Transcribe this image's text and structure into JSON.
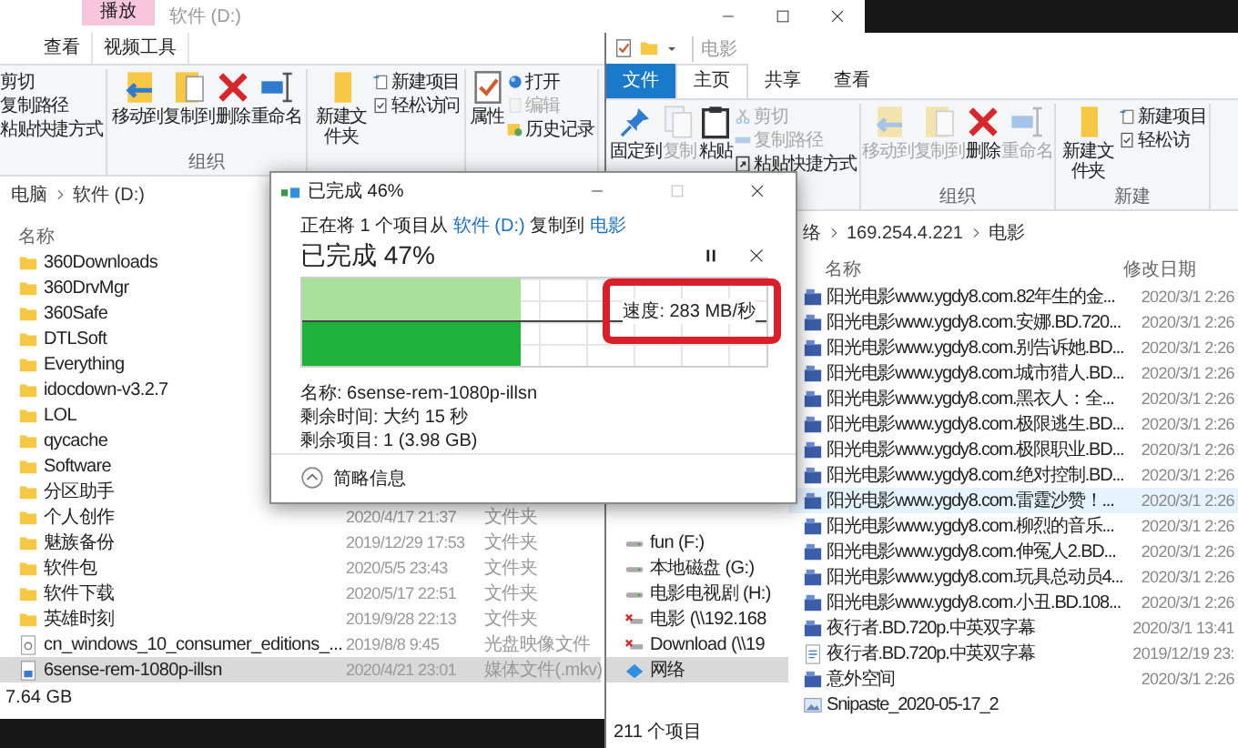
{
  "left_window": {
    "context_tab": "播放",
    "title": "软件 (D:)",
    "tabs": [
      {
        "label": "查看",
        "selected": false
      },
      {
        "label": "视频工具",
        "selected": false
      }
    ],
    "ribbon": [
      {
        "columns": [
          [
            {
              "kind": "cut",
              "label": "剪切",
              "disabled": false
            },
            {
              "kind": "copy-path",
              "label": "复制路径",
              "disabled": false
            },
            {
              "kind": "paste-shortcut",
              "label": "粘贴快捷方式",
              "disabled": false
            }
          ]
        ]
      },
      {
        "label": "组织",
        "columns": [
          [
            {
              "kind": "move-to",
              "label": "移动到",
              "disabled": false
            }
          ],
          [
            {
              "kind": "copy-to",
              "label": "复制到",
              "disabled": false
            }
          ],
          [
            {
              "kind": "delete",
              "label": "删除",
              "disabled": false
            }
          ],
          [
            {
              "kind": "rename",
              "label": "重命名",
              "disabled": false
            }
          ]
        ]
      },
      {
        "columns": [
          [
            {
              "kind": "new-folder",
              "label": "新建文件夹",
              "disabled": false
            }
          ],
          [
            {
              "kind": "new-item",
              "label": "新建项目",
              "disabled": false
            },
            {
              "kind": "easy-access",
              "label": "轻松访问",
              "disabled": false
            }
          ]
        ]
      },
      {
        "columns": [
          [
            {
              "kind": "properties",
              "label": "属性",
              "disabled": false
            }
          ],
          [
            {
              "kind": "open",
              "label": "打开",
              "disabled": false
            },
            {
              "kind": "edit",
              "label": "编辑",
              "disabled": true
            },
            {
              "kind": "history",
              "label": "历史记录",
              "disabled": false
            }
          ]
        ]
      }
    ],
    "breadcrumb": [
      "电脑",
      "软件 (D:)"
    ],
    "columns": [
      "名称"
    ],
    "files": [
      {
        "kind": "folder",
        "name": "360Downloads",
        "selected": false
      },
      {
        "kind": "folder",
        "name": "360DrvMgr",
        "selected": false
      },
      {
        "kind": "folder",
        "name": "360Safe",
        "selected": false
      },
      {
        "kind": "folder",
        "name": "DTLSoft",
        "selected": false
      },
      {
        "kind": "folder",
        "name": "Everything",
        "selected": false
      },
      {
        "kind": "folder",
        "name": "idocdown-v3.2.7",
        "selected": false
      },
      {
        "kind": "folder",
        "name": "LOL",
        "selected": false
      },
      {
        "kind": "folder",
        "name": "qycache",
        "selected": false
      },
      {
        "kind": "folder",
        "name": "Software",
        "selected": false
      },
      {
        "kind": "folder",
        "name": "分区助手",
        "selected": false
      },
      {
        "kind": "folder",
        "name": "个人创作",
        "date": "2020/4/17 21:37",
        "type": "文件夹",
        "selected": false
      },
      {
        "kind": "folder",
        "name": "魅族备份",
        "date": "2019/12/29 17:53",
        "type": "文件夹",
        "selected": false
      },
      {
        "kind": "folder",
        "name": "软件包",
        "date": "2020/5/5 23:43",
        "type": "文件夹",
        "selected": false
      },
      {
        "kind": "folder",
        "name": "软件下载",
        "date": "2020/5/17 22:51",
        "type": "文件夹",
        "selected": false
      },
      {
        "kind": "folder",
        "name": "英雄时刻",
        "date": "2019/9/28 22:13",
        "type": "文件夹",
        "selected": false
      },
      {
        "kind": "disc-image",
        "name": "cn_windows_10_consumer_editions_...",
        "date": "2019/8/8 9:45",
        "type": "光盘映像文件",
        "selected": false
      },
      {
        "kind": "video",
        "name": "6sense-rem-1080p-illsn",
        "date": "2020/4/21 23:01",
        "type": "媒体文件(.mkv)",
        "selected": true
      }
    ],
    "status": "7.64 GB"
  },
  "copy_dialog": {
    "title": "已完成 46%",
    "source_line": {
      "prefix": "正在将 1 个项目从",
      "source": "软件 (D:)",
      "middle": "复制到",
      "destination": "电影"
    },
    "progress_title": "已完成 47%",
    "level": 0.47,
    "speed": "速度: 283 MB/秒",
    "details": [
      "名称: 6sense-rem-1080p-illsn",
      "剩余时间: 大约 15 秒",
      "剩余项目: 1 (3.98 GB)"
    ],
    "toggle": "简略信息"
  },
  "right_window": {
    "title": "电影",
    "tabs": [
      {
        "label": "文件",
        "kind": "file",
        "selected": false
      },
      {
        "label": "主页",
        "kind": "tab",
        "selected": true
      },
      {
        "label": "共享",
        "kind": "tab",
        "selected": false
      },
      {
        "label": "查看",
        "kind": "tab",
        "selected": false
      }
    ],
    "ribbon": [
      {
        "columns": [
          [
            {
              "kind": "pin",
              "label": "固定到",
              "disabled": false
            }
          ],
          [
            {
              "kind": "copy",
              "label": "复制",
              "disabled": true
            }
          ],
          [
            {
              "kind": "paste",
              "label": "粘贴",
              "disabled": false
            }
          ],
          [
            {
              "kind": "cut",
              "label": "剪切",
              "disabled": true
            },
            {
              "kind": "copy-path",
              "label": "复制路径",
              "disabled": true
            },
            {
              "kind": "paste-shortcut",
              "label": "粘贴快捷方式",
              "disabled": false
            }
          ]
        ]
      },
      {
        "label": "组织",
        "columns": [
          [
            {
              "kind": "move-to",
              "label": "移动到",
              "disabled": true
            }
          ],
          [
            {
              "kind": "copy-to",
              "label": "复制到",
              "disabled": true
            }
          ],
          [
            {
              "kind": "delete",
              "label": "删除",
              "disabled": false
            }
          ],
          [
            {
              "kind": "rename",
              "label": "重命名",
              "disabled": true
            }
          ]
        ]
      },
      {
        "label": "新建",
        "columns": [
          [
            {
              "kind": "new-folder",
              "label": "新建文件夹",
              "disabled": false
            }
          ],
          [
            {
              "kind": "new-item",
              "label": "新建项目",
              "disabled": false
            },
            {
              "kind": "easy-access",
              "label": "轻松访",
              "disabled": false
            }
          ]
        ]
      }
    ],
    "breadcrumb": [
      "络",
      "169.254.4.221",
      "电影"
    ],
    "nav": [
      {
        "kind": "drive",
        "label": "fun (F:)",
        "selected": false
      },
      {
        "kind": "drive",
        "label": "本地磁盘 (G:)",
        "selected": false
      },
      {
        "kind": "drive",
        "label": "电影电视剧 (H:)",
        "selected": false
      },
      {
        "kind": "network-drive",
        "label": "电影 (\\\\192.168",
        "selected": false
      },
      {
        "kind": "network-drive",
        "label": "Download (\\\\19",
        "selected": false
      },
      {
        "kind": "network",
        "label": "网络",
        "selected": true
      }
    ],
    "columns": [
      "名称",
      "修改日期"
    ],
    "files": [
      {
        "kind": "media",
        "name": "阳光电影www.ygdy8.com.82年生的金...",
        "date": "2020/3/1 2:26",
        "selected": false
      },
      {
        "kind": "media",
        "name": "阳光电影www.ygdy8.com.安娜.BD.720...",
        "date": "2020/3/1 2:26",
        "selected": false
      },
      {
        "kind": "media",
        "name": "阳光电影www.ygdy8.com.别告诉她.BD...",
        "date": "2020/3/1 2:26",
        "selected": false
      },
      {
        "kind": "media",
        "name": "阳光电影www.ygdy8.com.城市猎人.BD...",
        "date": "2020/3/1 2:26",
        "selected": false
      },
      {
        "kind": "media",
        "name": "阳光电影www.ygdy8.com.黑衣人：全...",
        "date": "2020/3/1 2:26",
        "selected": false
      },
      {
        "kind": "media",
        "name": "阳光电影www.ygdy8.com.极限逃生.BD...",
        "date": "2020/3/1 2:26",
        "selected": false
      },
      {
        "kind": "media",
        "name": "阳光电影www.ygdy8.com.极限职业.BD...",
        "date": "2020/3/1 2:26",
        "selected": false
      },
      {
        "kind": "media",
        "name": "阳光电影www.ygdy8.com.绝对控制.BD...",
        "date": "2020/3/1 2:26",
        "selected": false
      },
      {
        "kind": "media",
        "name": "阳光电影www.ygdy8.com.雷霆沙赞！...",
        "date": "2020/3/1 2:26",
        "selected": true
      },
      {
        "kind": "media",
        "name": "阳光电影www.ygdy8.com.柳烈的音乐...",
        "date": "2020/3/1 2:26",
        "selected": false
      },
      {
        "kind": "media",
        "name": "阳光电影www.ygdy8.com.伸冤人2.BD...",
        "date": "2020/3/1 2:26",
        "selected": false
      },
      {
        "kind": "media",
        "name": "阳光电影www.ygdy8.com.玩具总动员4...",
        "date": "2020/3/1 2:26",
        "selected": false
      },
      {
        "kind": "media",
        "name": "阳光电影www.ygdy8.com.小丑.BD.108...",
        "date": "2020/3/1 2:26",
        "selected": false
      },
      {
        "kind": "media",
        "name": "夜行者.BD.720p.中英双字幕",
        "date": "2020/3/1 13:41",
        "selected": false
      },
      {
        "kind": "document",
        "name": "夜行者.BD.720p.中英双字幕",
        "date": "2019/12/19 23:",
        "selected": false
      },
      {
        "kind": "media",
        "name": "意外空间",
        "date": "2020/3/1 2:26",
        "selected": false
      },
      {
        "kind": "image",
        "name": "Snipaste_2020-05-17_2",
        "selected": false
      }
    ],
    "status": "211 个项目"
  }
}
